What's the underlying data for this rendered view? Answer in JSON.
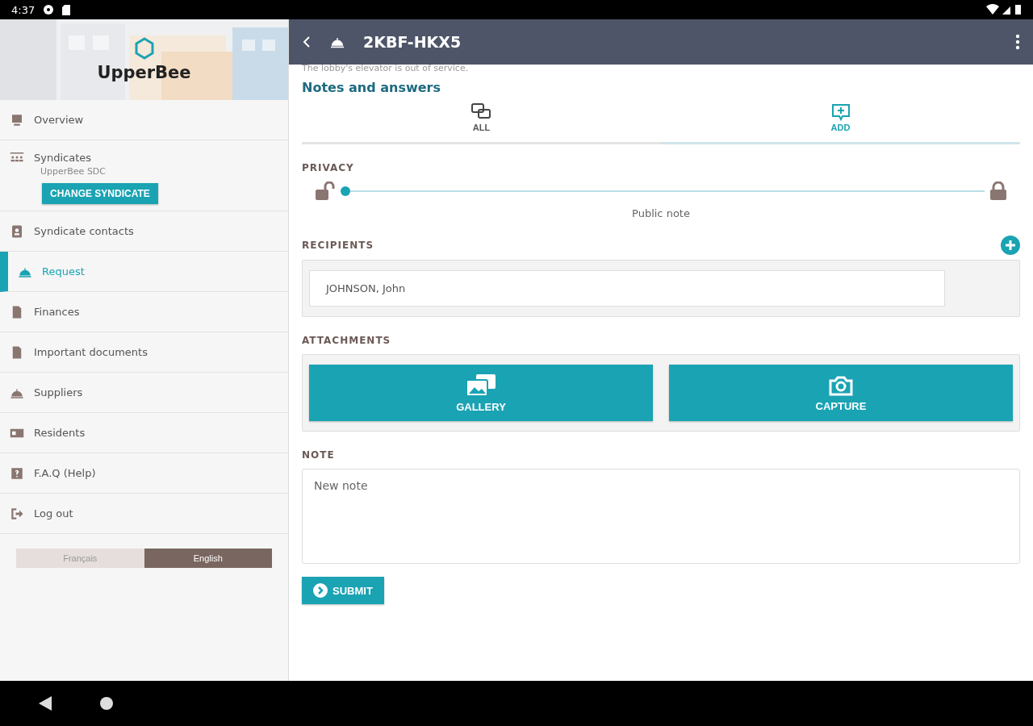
{
  "status_bar": {
    "time": "4:37"
  },
  "sidebar": {
    "brand": "UpperBee",
    "items": [
      {
        "kind": "plain",
        "label": "Overview",
        "selected": false
      },
      {
        "kind": "syndicate",
        "label": "Syndicates",
        "sublabel": "UpperBee SDC",
        "button": "CHANGE SYNDICATE",
        "selected": false
      },
      {
        "kind": "plain",
        "label": "Syndicate contacts",
        "selected": false
      },
      {
        "kind": "plain",
        "label": "Request",
        "selected": true
      },
      {
        "kind": "plain",
        "label": "Finances",
        "selected": false
      },
      {
        "kind": "plain",
        "label": "Important documents",
        "selected": false
      },
      {
        "kind": "plain",
        "label": "Suppliers",
        "selected": false
      },
      {
        "kind": "plain",
        "label": "Residents",
        "selected": false
      },
      {
        "kind": "plain",
        "label": "F.A.Q (Help)",
        "selected": false
      },
      {
        "kind": "plain",
        "label": "Log out",
        "selected": false
      }
    ],
    "languages": [
      {
        "label": "Français",
        "selected": false
      },
      {
        "label": "English",
        "selected": true
      }
    ]
  },
  "header": {
    "title": "2KBF-HKX5"
  },
  "description": "The lobby's elevator is out of service.",
  "notes": {
    "title": "Notes and answers",
    "tabs": [
      {
        "label": "ALL",
        "selected": false
      },
      {
        "label": "ADD",
        "selected": true
      }
    ],
    "privacy": {
      "label": "PRIVACY",
      "level": 0,
      "reading": "Public note"
    },
    "recipients": {
      "label": "RECIPIENTS",
      "items": [
        "JOHNSON, John"
      ]
    },
    "attachments": {
      "label": "ATTACHMENTS",
      "buttons": [
        {
          "label": "GALLERY"
        },
        {
          "label": "CAPTURE"
        }
      ]
    },
    "note": {
      "label": "NOTE",
      "placeholder": "New note"
    },
    "submit": "SUBMIT"
  }
}
